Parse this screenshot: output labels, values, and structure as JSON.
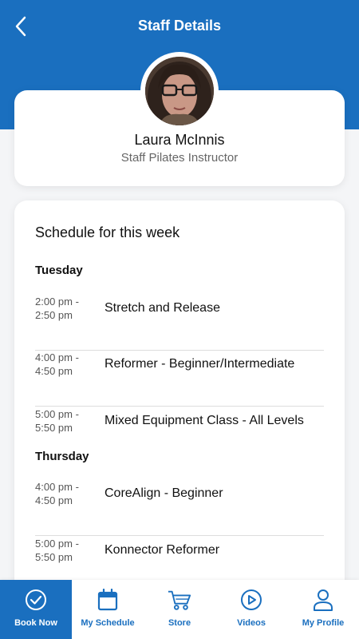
{
  "header": {
    "title": "Staff Details",
    "background_color": "#1a6fbf",
    "back_icon": "chevron-left-icon"
  },
  "profile": {
    "name": "Laura McInnis",
    "role": "Staff Pilates Instructor"
  },
  "schedule": {
    "title": "Schedule for this week",
    "days": [
      {
        "day": "Tuesday",
        "classes": [
          {
            "start": "2:00 pm -",
            "end": "2:50 pm",
            "name": "Stretch and Release"
          },
          {
            "start": "4:00 pm -",
            "end": "4:50 pm",
            "name": "Reformer - Beginner/Intermediate"
          },
          {
            "start": "5:00 pm -",
            "end": "5:50 pm",
            "name": "Mixed Equipment Class - All Levels"
          }
        ]
      },
      {
        "day": "Thursday",
        "classes": [
          {
            "start": "4:00 pm -",
            "end": "4:50 pm",
            "name": "CoreAlign - Beginner"
          },
          {
            "start": "5:00 pm -",
            "end": "5:50 pm",
            "name": "Konnector Reformer"
          }
        ]
      }
    ]
  },
  "tabbar": {
    "accent_color": "#1a6fbf",
    "items": [
      {
        "label": "Book Now",
        "icon": "check-circle-icon",
        "active": true
      },
      {
        "label": "My Schedule",
        "icon": "calendar-icon",
        "active": false
      },
      {
        "label": "Store",
        "icon": "cart-icon",
        "active": false
      },
      {
        "label": "Videos",
        "icon": "play-circle-icon",
        "active": false
      },
      {
        "label": "My Profile",
        "icon": "user-icon",
        "active": false
      }
    ]
  }
}
